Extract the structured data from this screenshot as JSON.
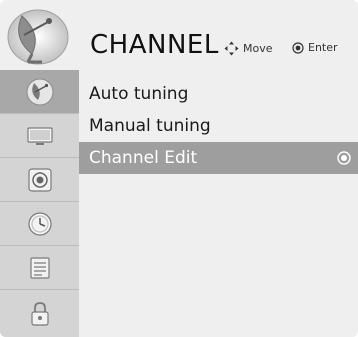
{
  "header": {
    "title": "CHANNEL",
    "hints": {
      "move": "Move",
      "enter": "Enter"
    }
  },
  "tabs": [
    {
      "icon": "satellite-dish-icon",
      "active": true
    },
    {
      "icon": "monitor-icon",
      "active": false
    },
    {
      "icon": "speaker-icon",
      "active": false
    },
    {
      "icon": "clock-icon",
      "active": false
    },
    {
      "icon": "lock-list-icon",
      "active": false
    },
    {
      "icon": "padlock-icon",
      "active": false
    }
  ],
  "menu": {
    "items": [
      {
        "label": "Auto tuning",
        "selected": false
      },
      {
        "label": "Manual tuning",
        "selected": false
      },
      {
        "label": "Channel Edit",
        "selected": true
      }
    ]
  },
  "colors": {
    "header_bg": "#efefef",
    "tab_bg": "#d4d4d4",
    "tab_active_bg": "#a8a8a8",
    "selected_item_bg": "#9e9e9e"
  }
}
